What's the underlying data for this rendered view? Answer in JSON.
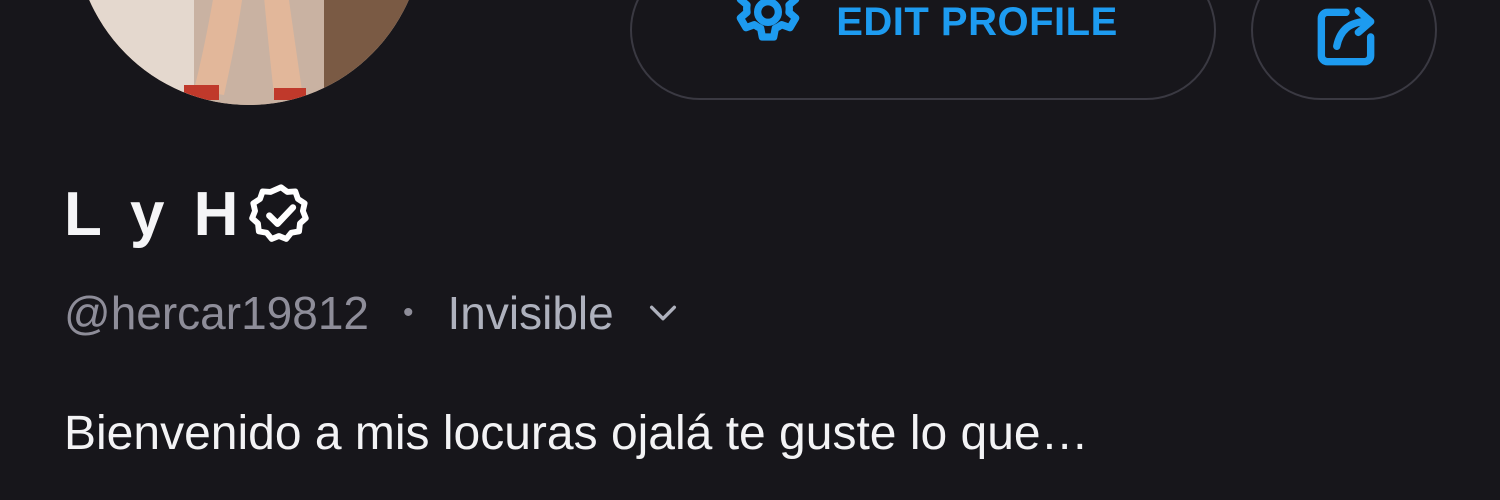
{
  "profile": {
    "display_name": "L y H",
    "handle": "@hercar19812",
    "separator": "•",
    "status": "Invisible",
    "bio": "Bienvenido a mis locuras ojalá te guste lo que…",
    "verified": true
  },
  "actions": {
    "edit_profile_label": "EDIT PROFILE"
  },
  "icons": {
    "edit": "gear-icon",
    "share": "share-icon",
    "verified": "verified-badge-icon",
    "status_dropdown": "chevron-down-icon"
  },
  "colors": {
    "background": "#17161b",
    "accent": "#1d9bf0",
    "muted_text": "#8e8d99",
    "border": "#3a3942"
  }
}
